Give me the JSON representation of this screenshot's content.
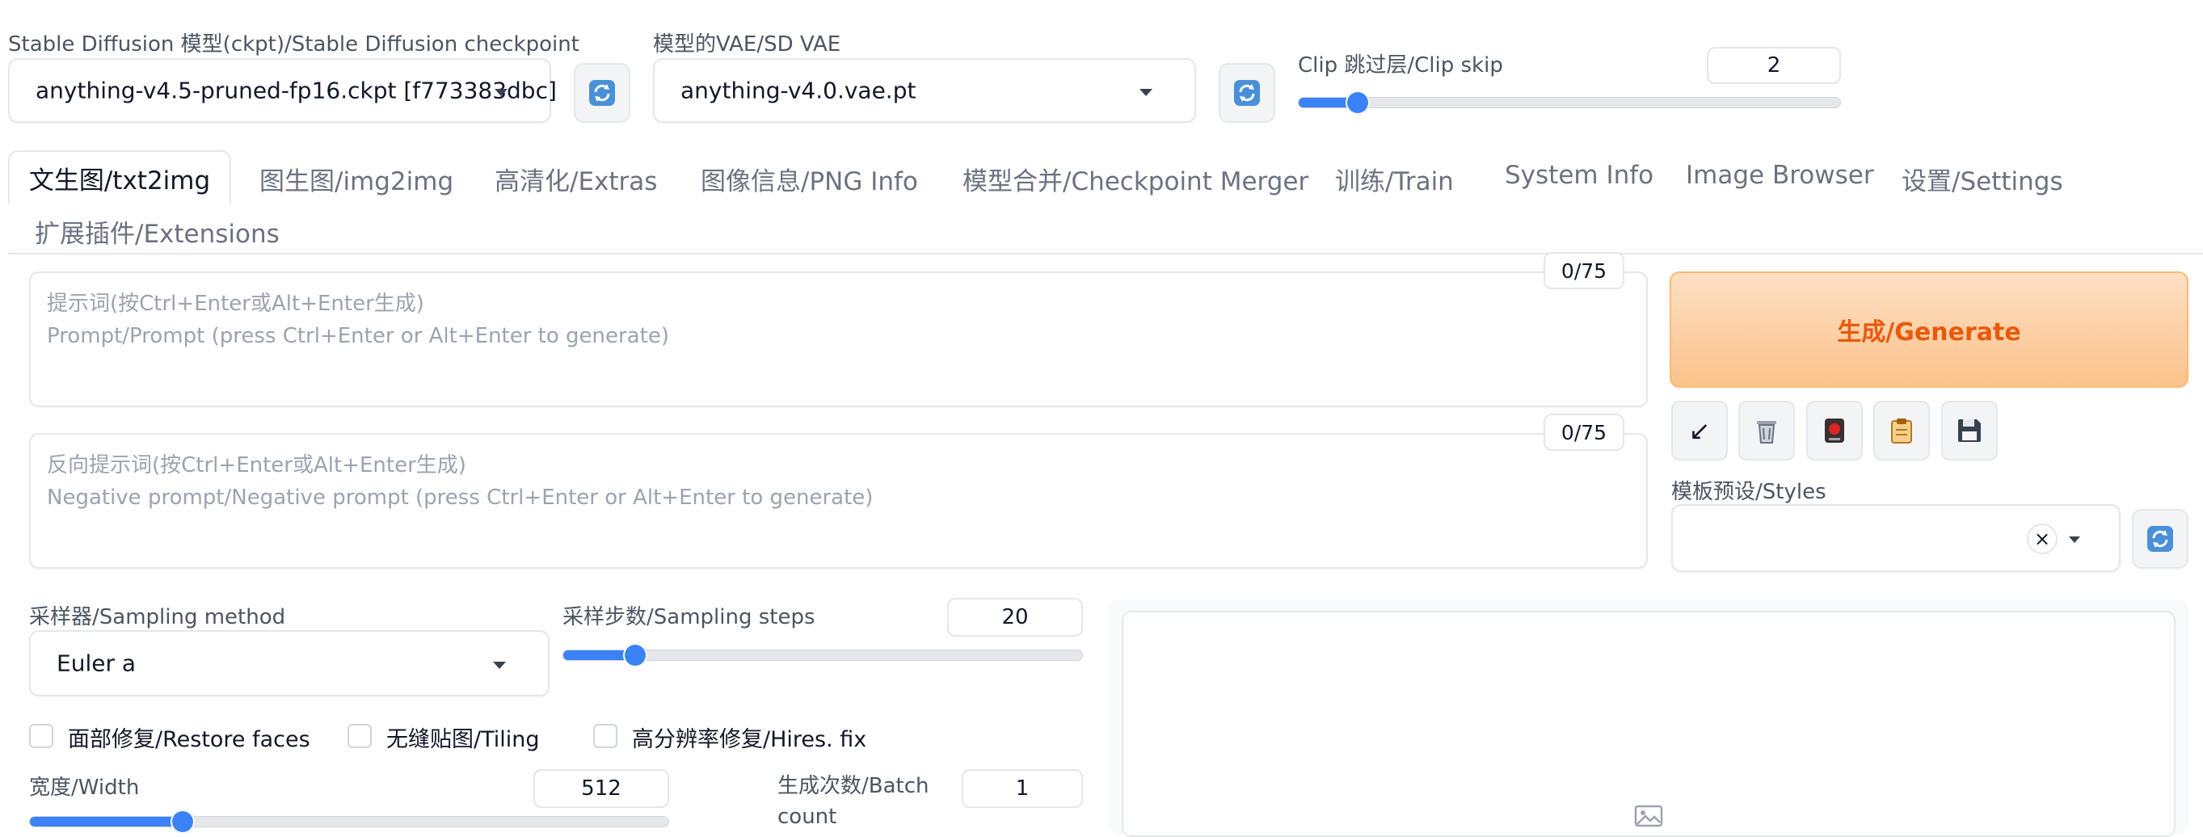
{
  "top": {
    "checkpoint": {
      "label": "Stable Diffusion 模型(ckpt)/Stable Diffusion checkpoint",
      "value": "anything-v4.5-pruned-fp16.ckpt [f773383dbc]"
    },
    "vae": {
      "label": "模型的VAE/SD VAE",
      "value": "anything-v4.0.vae.pt"
    },
    "clip_skip": {
      "label": "Clip 跳过层/Clip skip",
      "value": "2",
      "fraction": 0.11
    }
  },
  "tabs": [
    {
      "label": "文生图/txt2img",
      "active": true
    },
    {
      "label": "图生图/img2img"
    },
    {
      "label": "高清化/Extras"
    },
    {
      "label": "图像信息/PNG Info"
    },
    {
      "label": "模型合并/Checkpoint Merger"
    },
    {
      "label": "训练/Train"
    },
    {
      "label": "System Info"
    },
    {
      "label": "Image Browser"
    },
    {
      "label": "设置/Settings"
    },
    {
      "label": "扩展插件/Extensions"
    }
  ],
  "prompt": {
    "counter": "0/75",
    "placeholder_line1": "提示词(按Ctrl+Enter或Alt+Enter生成)",
    "placeholder_line2": "Prompt/Prompt (press Ctrl+Enter or Alt+Enter to generate)"
  },
  "negative_prompt": {
    "counter": "0/75",
    "placeholder_line1": "反向提示词(按Ctrl+Enter或Alt+Enter生成)",
    "placeholder_line2": "Negative prompt/Negative prompt (press Ctrl+Enter or Alt+Enter to generate)"
  },
  "generate": {
    "label": "生成/Generate"
  },
  "tools": [
    {
      "icon": "arrow-down-left-icon",
      "glyph": "↙"
    },
    {
      "icon": "trash-icon",
      "glyph": "🗑"
    },
    {
      "icon": "red-record-icon",
      "glyph": "●"
    },
    {
      "icon": "clipboard-icon",
      "glyph": "📋"
    },
    {
      "icon": "save-icon",
      "glyph": "💾"
    }
  ],
  "styles": {
    "label": "模板预设/Styles",
    "value": ""
  },
  "sampling": {
    "method_label": "采样器/Sampling method",
    "method_value": "Euler a",
    "steps_label": "采样步数/Sampling steps",
    "steps_value": "20",
    "steps_fraction": 0.14
  },
  "options": {
    "restore_faces": "面部修复/Restore faces",
    "tiling": "无缝贴图/Tiling",
    "hires_fix": "高分辨率修复/Hires. fix"
  },
  "width": {
    "label": "宽度/Width",
    "value": "512",
    "fraction": 0.24
  },
  "batch_count": {
    "label_line1": "生成次数/Batch",
    "label_line2": "count",
    "value": "1"
  },
  "colors": {
    "accent": "#3b82f6",
    "generate_text": "#ea580c",
    "generate_bg": "#fbc28b"
  }
}
